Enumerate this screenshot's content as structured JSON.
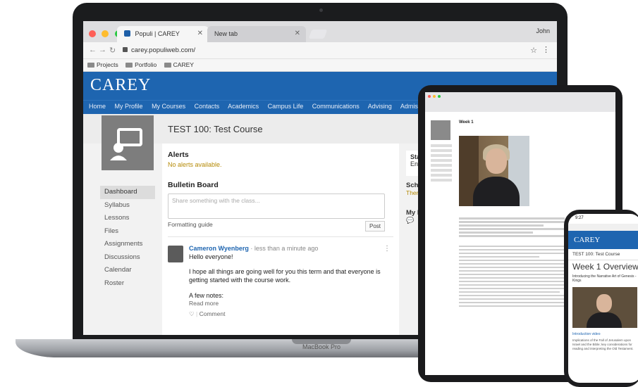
{
  "device": {
    "brand_label": "MacBook Pro"
  },
  "browser": {
    "tabs": [
      {
        "label": "Populi | CAREY",
        "active": true
      },
      {
        "label": "New tab",
        "active": false
      }
    ],
    "profile": "John",
    "url": "carey.populiweb.com/",
    "bookmarks": [
      "Projects",
      "Portfolio",
      "CAREY"
    ]
  },
  "site": {
    "logo": "CAREY",
    "nav": [
      "Home",
      "My Profile",
      "My Courses",
      "Contacts",
      "Academics",
      "Campus Life",
      "Communications",
      "Advising",
      "Admissions"
    ],
    "brand_color": "#1e65b0"
  },
  "course": {
    "title": "TEST 100: Test Course",
    "sidebar": [
      "Dashboard",
      "Syllabus",
      "Lessons",
      "Files",
      "Assignments",
      "Discussions",
      "Calendar",
      "Roster"
    ],
    "active_item": "Dashboard",
    "alerts": {
      "heading": "Alerts",
      "text": "No alerts available."
    },
    "bulletin": {
      "heading": "Bulletin Board",
      "placeholder": "Share something with the class...",
      "formatting_guide": "Formatting guide",
      "post_button": "Post"
    },
    "post": {
      "author": "Cameron Wyenberg",
      "meta": "· less than a minute ago",
      "line1": "Hello everyone!",
      "line2": "I hope all things are going well for you this term and that everyone is getting started with the course work.",
      "line3": "A few notes:",
      "read_more": "Read more",
      "action": "Comment"
    },
    "right": {
      "box1": "Star",
      "box1_sub": "Enro",
      "sched_title": "Sche",
      "sched_text": "Ther",
      "my_title": "My D"
    }
  },
  "tablet": {
    "week_title": "Week 1"
  },
  "phone": {
    "time": "9:27",
    "logo": "CAREY",
    "course": "TEST 100: Test Course",
    "week": "Week 1 Overview",
    "subtitle": "Introducing the Narrative Art of Genesis - Kings",
    "link": "Introduction video",
    "text": "Implications of the Fall of Jerusalem upon Israel and the Bible; key considerations for reading and interpreting the Old Testament."
  }
}
